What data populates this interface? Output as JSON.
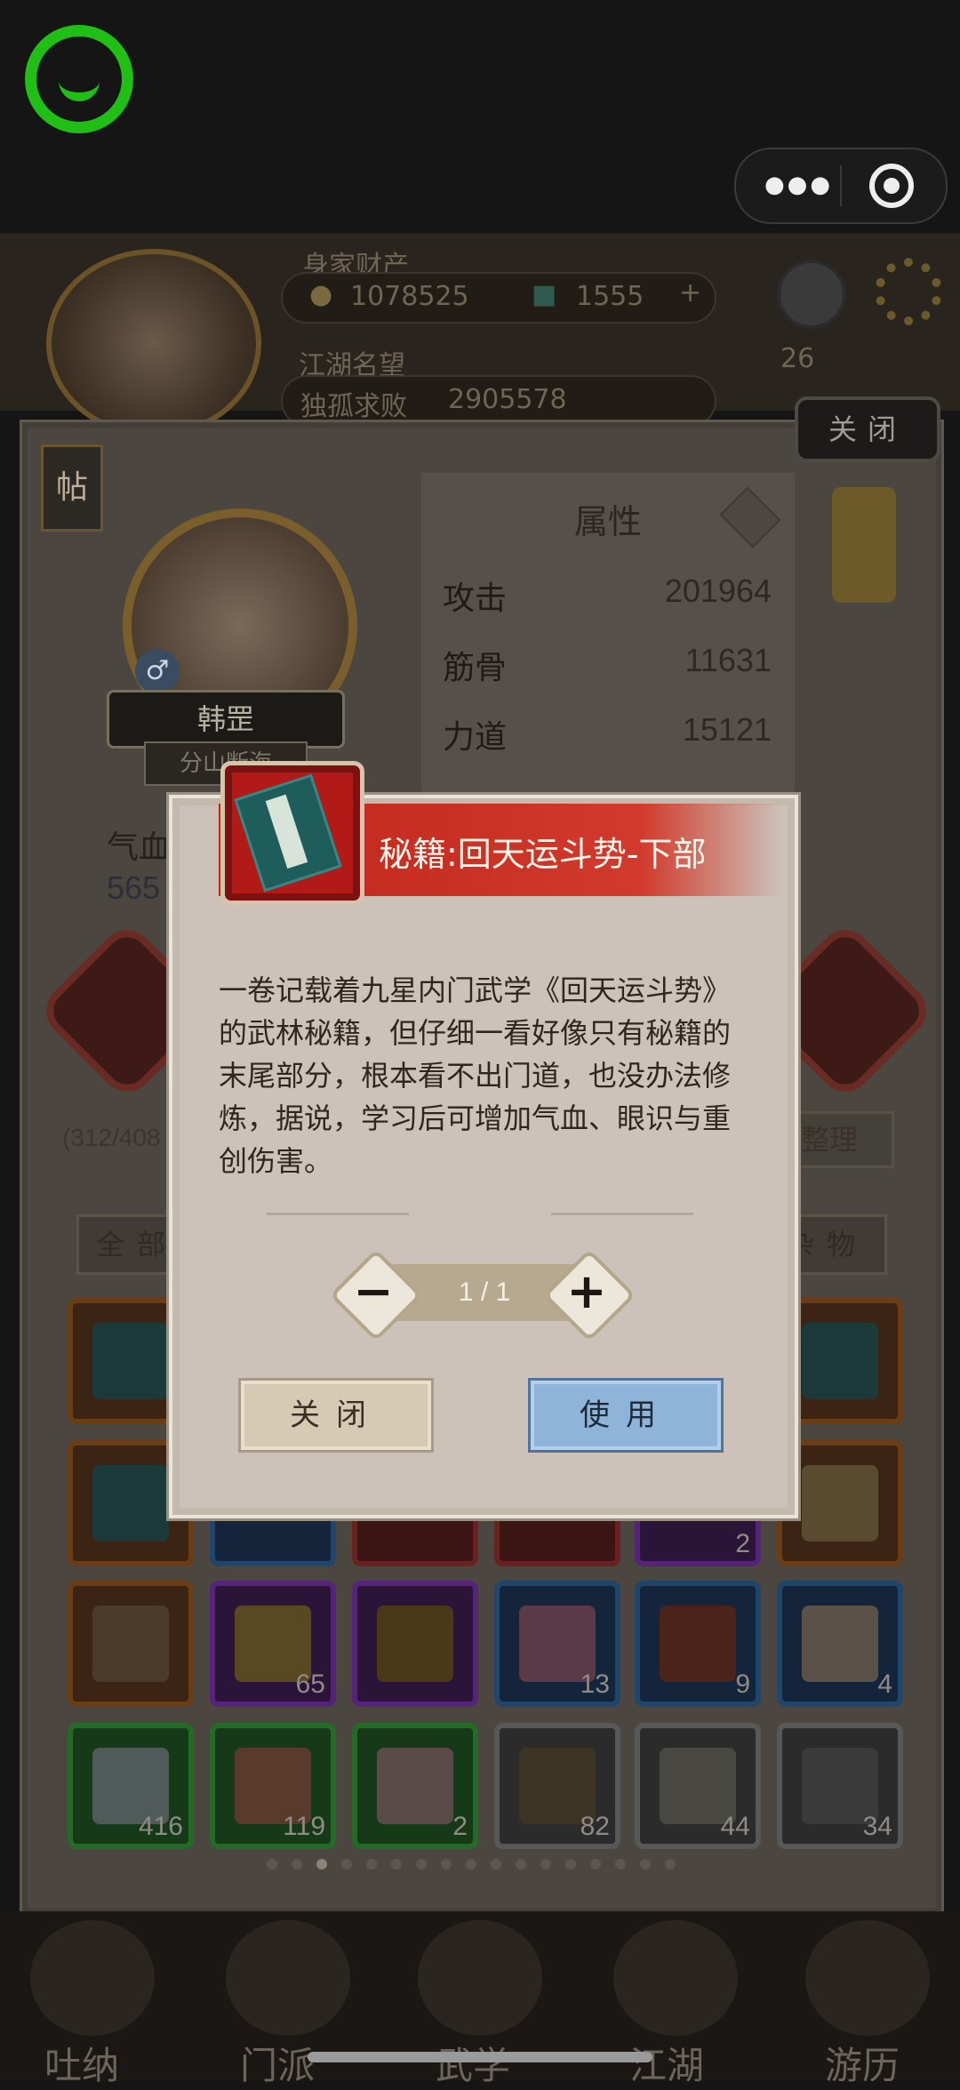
{
  "top_bar": {
    "more_icon": "more-dots-icon",
    "close_icon": "target-icon"
  },
  "header": {
    "assets_label": "身家财产",
    "gold": "1078525",
    "jade": "1555",
    "fame_label": "江湖名望",
    "fame_title": "独孤求败",
    "fame_value": "2905578",
    "yinyang_count": "26"
  },
  "panel": {
    "close_label": "关闭",
    "tie_label": "帖",
    "character": {
      "name": "韩罡",
      "sect": "分山断海",
      "gender": "♂"
    },
    "attributes": {
      "title": "属性",
      "rows": [
        {
          "label": "攻击",
          "value": "201964"
        },
        {
          "label": "筋骨",
          "value": "11631"
        },
        {
          "label": "力道",
          "value": "15121"
        }
      ]
    },
    "blood_label": "气血",
    "blood_value": "565",
    "capacity": "(312/408",
    "sort_label": "整理",
    "tab_all": "全部",
    "tab_misc": "杂物",
    "inventory_counts": [
      "2",
      "65",
      "13",
      "9",
      "4",
      "416",
      "119",
      "2",
      "82",
      "44",
      "34"
    ]
  },
  "bottom_nav": [
    "吐纳",
    "门派",
    "武学",
    "江湖",
    "游历"
  ],
  "dialog": {
    "title": "秘籍:回天运斗势-下部",
    "description": "一卷记载着九星内门武学《回天运斗势》的武林秘籍，但仔细一看好像只有秘籍的末尾部分，根本看不出门道，也没办法修炼，据说，学习后可增加气血、眼识与重创伤害。",
    "quantity": "1 / 1",
    "minus": "−",
    "plus": "+",
    "close_button": "关闭",
    "use_button": "使用"
  }
}
